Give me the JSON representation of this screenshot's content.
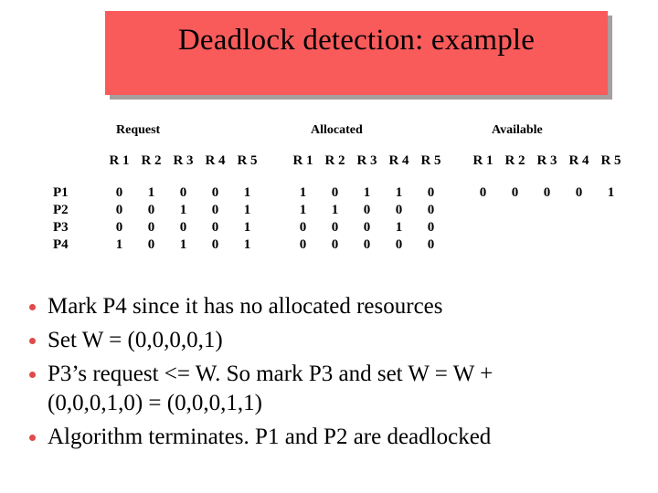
{
  "slide": {
    "title": "Deadlock detection: example",
    "banner_color": "#f95b5b",
    "bullet_color": "#e04a4a"
  },
  "table": {
    "groups": [
      {
        "name": "request_group",
        "label": "Request"
      },
      {
        "name": "allocated_group",
        "label": "Allocated"
      },
      {
        "name": "available_group",
        "label": "Available"
      }
    ],
    "resource_headers": [
      "R 1",
      "R 2",
      "R 3",
      "R 4",
      "R 5"
    ],
    "process_labels": [
      "P1",
      "P2",
      "P3",
      "P4"
    ],
    "request": [
      [
        "0",
        "1",
        "0",
        "0",
        "1"
      ],
      [
        "0",
        "0",
        "1",
        "0",
        "1"
      ],
      [
        "0",
        "0",
        "0",
        "0",
        "1"
      ],
      [
        "1",
        "0",
        "1",
        "0",
        "1"
      ]
    ],
    "allocated": [
      [
        "1",
        "0",
        "1",
        "1",
        "0"
      ],
      [
        "1",
        "1",
        "0",
        "0",
        "0"
      ],
      [
        "0",
        "0",
        "0",
        "1",
        "0"
      ],
      [
        "0",
        "0",
        "0",
        "0",
        "0"
      ]
    ],
    "available": [
      [
        "0",
        "0",
        "0",
        "0",
        "1"
      ]
    ]
  },
  "bullets": [
    {
      "line1": "Mark P4 since it has no allocated resources",
      "line2": ""
    },
    {
      "line1": "Set W = (0,0,0,0,1)",
      "line2": ""
    },
    {
      "line1": "P3’s request <= W. So mark P3 and set W = W +",
      "line2": "(0,0,0,1,0) = (0,0,0,1,1)"
    },
    {
      "line1": "Algorithm terminates. P1 and P2 are deadlocked",
      "line2": ""
    }
  ]
}
